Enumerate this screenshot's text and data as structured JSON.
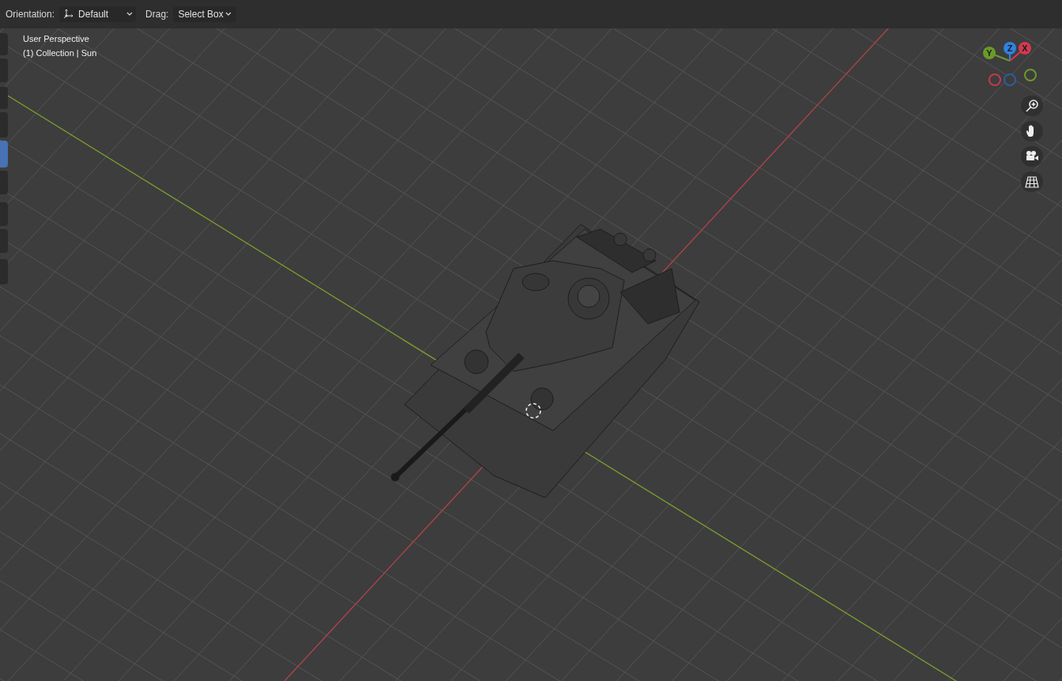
{
  "header": {
    "orientation": {
      "label": "Orientation:",
      "value": "Default"
    },
    "drag": {
      "label": "Drag:",
      "value": "Select Box"
    }
  },
  "viewport": {
    "info": [
      "User Perspective",
      "(1) Collection | Sun"
    ]
  },
  "toolbar": {
    "tools": [
      {
        "selected": false
      },
      {
        "selected": false
      },
      {
        "selected": false
      },
      {
        "selected": false
      },
      {
        "selected": true
      },
      {
        "selected": false
      },
      {
        "selected": false
      },
      {
        "selected": false
      },
      {
        "selected": false
      }
    ]
  },
  "gizmo": {
    "axes": [
      {
        "label": "Y",
        "color": "#6a9a2a"
      },
      {
        "label": "Z",
        "color": "#2f83e0"
      },
      {
        "label": "X",
        "color": "#d23a4f"
      }
    ],
    "negative_axes": [
      {
        "color": "#c43a4a"
      },
      {
        "color": "#2d5f9a"
      },
      {
        "color": "#6a9a2a"
      }
    ]
  }
}
